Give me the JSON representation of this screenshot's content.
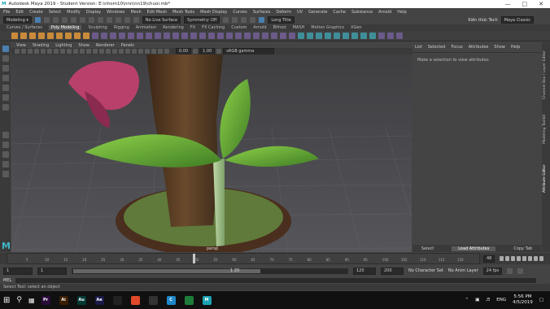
{
  "window": {
    "title": "Autodesk Maya 2019 - Student Version: E:\\nhom10\\nnn\\nn19\\chuoi.mb*"
  },
  "menubar": [
    "File",
    "Edit",
    "Create",
    "Select",
    "Modify",
    "Display",
    "Windows",
    "Mesh",
    "Edit Mesh",
    "Mesh Tools",
    "Mesh Display",
    "Curves",
    "Surfaces",
    "Deform",
    "UV",
    "Generate",
    "Cache",
    "Substance",
    "Arnold",
    "Help"
  ],
  "statusline": {
    "mode": "Modeling",
    "live_surface": "No Live Surface",
    "symmetry": "Symmetry: Off",
    "workspace_label": "Long Title",
    "account": "Kiến thức Tech",
    "workspace": "Maya Classic"
  },
  "shelf_tabs": [
    "Curves / Surfaces",
    "Poly Modeling",
    "Sculpting",
    "Rigging",
    "Animation",
    "Rendering",
    "FX",
    "FX Caching",
    "Custom",
    "Arnold",
    "Bifrost",
    "MASH",
    "Motion Graphics",
    "XGen"
  ],
  "shelf_active": "Poly Modeling",
  "viewport": {
    "menu": [
      "View",
      "Shading",
      "Lighting",
      "Show",
      "Renderer",
      "Panels"
    ],
    "colorspace": "sRGB gamma",
    "value_a": "0.00",
    "value_b": "1.00",
    "camera": "persp"
  },
  "attr_panel": {
    "tabs": [
      "List",
      "Selected",
      "Focus",
      "Attributes",
      "Show",
      "Help"
    ],
    "message": "Make a selection to view attributes",
    "bottom_left": "Select",
    "bottom_middle": "Load Attributes",
    "bottom_right": "Copy Tab"
  },
  "side_tabs": [
    "Channel Box / Layer Editor",
    "Modeling Toolkit",
    "Attribute Editor"
  ],
  "timeslider": {
    "current_frame": "48",
    "tick_labels": [
      "5",
      "10",
      "15",
      "20",
      "25",
      "30",
      "35",
      "40",
      "45",
      "50",
      "55",
      "60",
      "65",
      "70",
      "75",
      "80",
      "85",
      "90",
      "95",
      "100",
      "105",
      "110",
      "115",
      "120"
    ]
  },
  "range": {
    "start": "1",
    "playback_start": "1",
    "range_label": "1 20",
    "playback_end": "120",
    "end": "200",
    "character_set": "No Character Set",
    "anim_layer": "No Anim Layer",
    "fps": "24 fps"
  },
  "cmdline": {
    "lang": "MEL",
    "help": "Select Tool: select an object"
  },
  "taskbar": {
    "apps": [
      {
        "label": "Pr",
        "color": "#2a0b3a"
      },
      {
        "label": "Ai",
        "color": "#3a1e00"
      },
      {
        "label": "Au",
        "color": "#003a35"
      },
      {
        "label": "Ae",
        "color": "#1a1a4a"
      },
      {
        "label": "",
        "color": "#222"
      },
      {
        "label": "",
        "color": "#e04a2a"
      },
      {
        "label": "",
        "color": "#333"
      },
      {
        "label": "C",
        "color": "#1e88c8"
      },
      {
        "label": "",
        "color": "#1e7d3a"
      },
      {
        "label": "M",
        "color": "#1aa3b2"
      }
    ],
    "lang": "ENG",
    "time": "5:56 PM",
    "date": "4/5/2019"
  },
  "colors": {
    "accent": "#3fb8c8",
    "leaf": "#6bb43a",
    "flower": "#b8406a",
    "trunk": "#5a3a22"
  }
}
